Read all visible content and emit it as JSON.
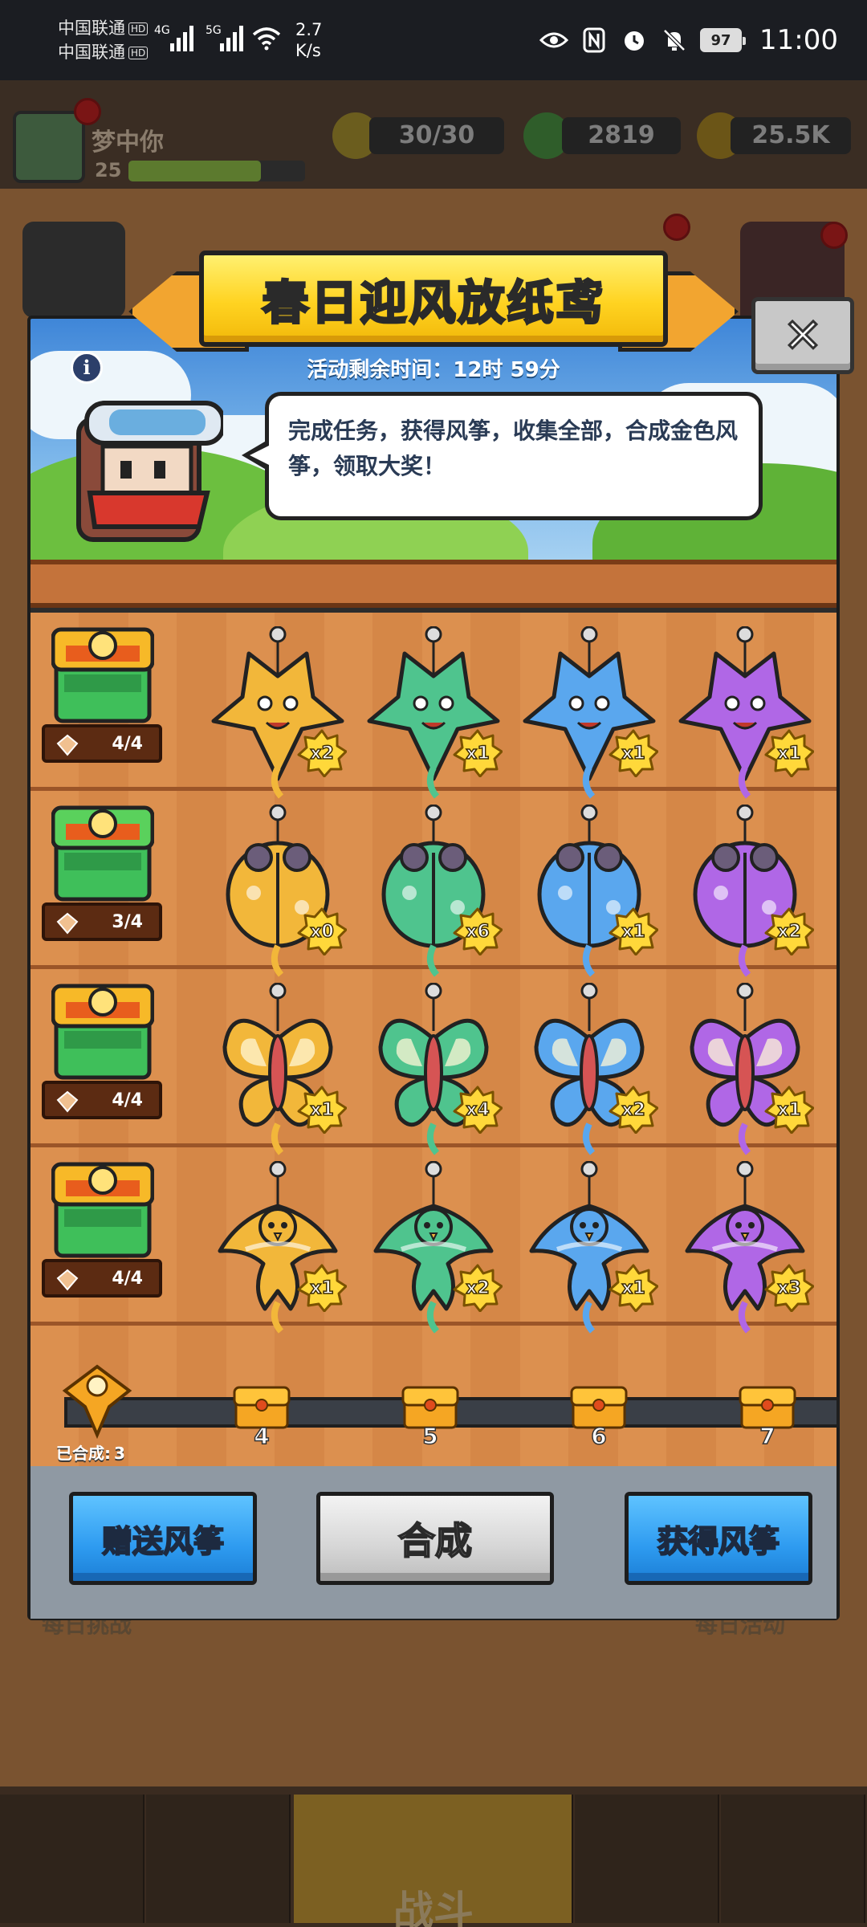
{
  "status_bar": {
    "carrier1": "中国联通",
    "carrier2": "中国联通",
    "hd": "HD",
    "net1": "4G",
    "net2": "5G",
    "speed_value": "2.7",
    "speed_unit": "K/s",
    "battery": "97",
    "time": "11:00"
  },
  "background": {
    "player_name": "梦中你",
    "player_level": "25",
    "energy": "30/30",
    "gems": "2819",
    "gold": "25.5K",
    "nav_fight": "战斗",
    "side_left": "每日挑战",
    "side_right": "每日活动"
  },
  "modal": {
    "title": "春日迎风放纸鸢",
    "timer_label": "活动剩余时间：",
    "timer_value": "12时 59分",
    "info_symbol": "i",
    "close_symbol": "✕",
    "speech": "完成任务，获得风筝，收集全部，合成金色风筝，领取大奖！",
    "rows": [
      {
        "progress": "4/4",
        "counts": [
          "x2",
          "x1",
          "x1",
          "x1"
        ]
      },
      {
        "progress": "3/4",
        "counts": [
          "x0",
          "x6",
          "x1",
          "x2"
        ]
      },
      {
        "progress": "4/4",
        "counts": [
          "x1",
          "x4",
          "x2",
          "x1"
        ]
      },
      {
        "progress": "4/4",
        "counts": [
          "x1",
          "x2",
          "x1",
          "x3"
        ]
      }
    ],
    "kite_colors": [
      "#f2b73a",
      "#4fc48e",
      "#5aa7ee",
      "#b067e6"
    ],
    "combined_label": "已合成:",
    "combined_count": "3",
    "milestones": [
      "4",
      "5",
      "6",
      "7"
    ],
    "buttons": {
      "gift": "赠送风筝",
      "combine": "合成",
      "obtain": "获得风筝"
    }
  }
}
